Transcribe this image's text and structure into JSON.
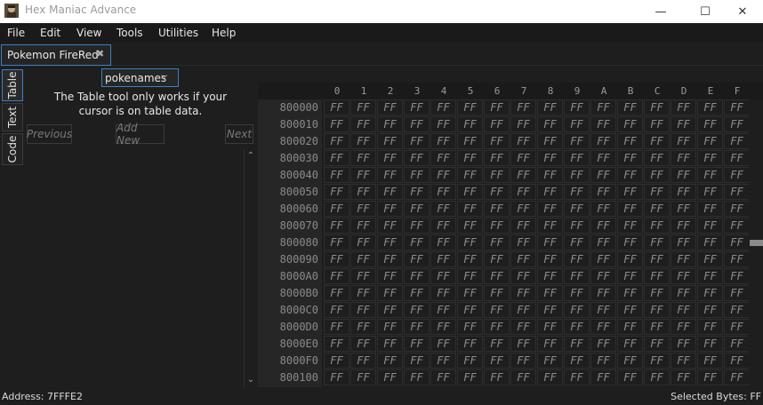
{
  "window": {
    "title": "Hex Maniac Advance",
    "icon": "app-logo-icon",
    "min_icon": "—",
    "max_icon": "☐",
    "close_icon": "✕"
  },
  "menu": [
    "File",
    "Edit",
    "View",
    "Tools",
    "Utilities",
    "Help"
  ],
  "document_tab": {
    "label": "Pokemon FireRed",
    "close_glyph": "✖"
  },
  "side_tabs": [
    "Table",
    "Text",
    "Code"
  ],
  "table_tool": {
    "dropdown_value": "pokenames",
    "dropdown_chevron": "⌵",
    "message_line1": "The Table tool only works if your",
    "message_line2": "cursor is on table data.",
    "previous_label": "Previous",
    "add_new_label": "Add New",
    "next_label": "Next",
    "scroll_up": "⌃",
    "scroll_down": "⌄"
  },
  "hex_view": {
    "columns": [
      "0",
      "1",
      "2",
      "3",
      "4",
      "5",
      "6",
      "7",
      "8",
      "9",
      "A",
      "B",
      "C",
      "D",
      "E",
      "F"
    ],
    "addresses": [
      "800000",
      "800010",
      "800020",
      "800030",
      "800040",
      "800050",
      "800060",
      "800070",
      "800080",
      "800090",
      "8000A0",
      "8000B0",
      "8000C0",
      "8000D0",
      "8000E0",
      "8000F0",
      "800100"
    ],
    "byte_value": "FF"
  },
  "status": {
    "address": "Address: 7FFFE2",
    "selected": "Selected Bytes: FF"
  },
  "colors": {
    "accent": "#3d7fc6",
    "background": "#1e1e1e",
    "hex_text": "#8c8c8c"
  }
}
